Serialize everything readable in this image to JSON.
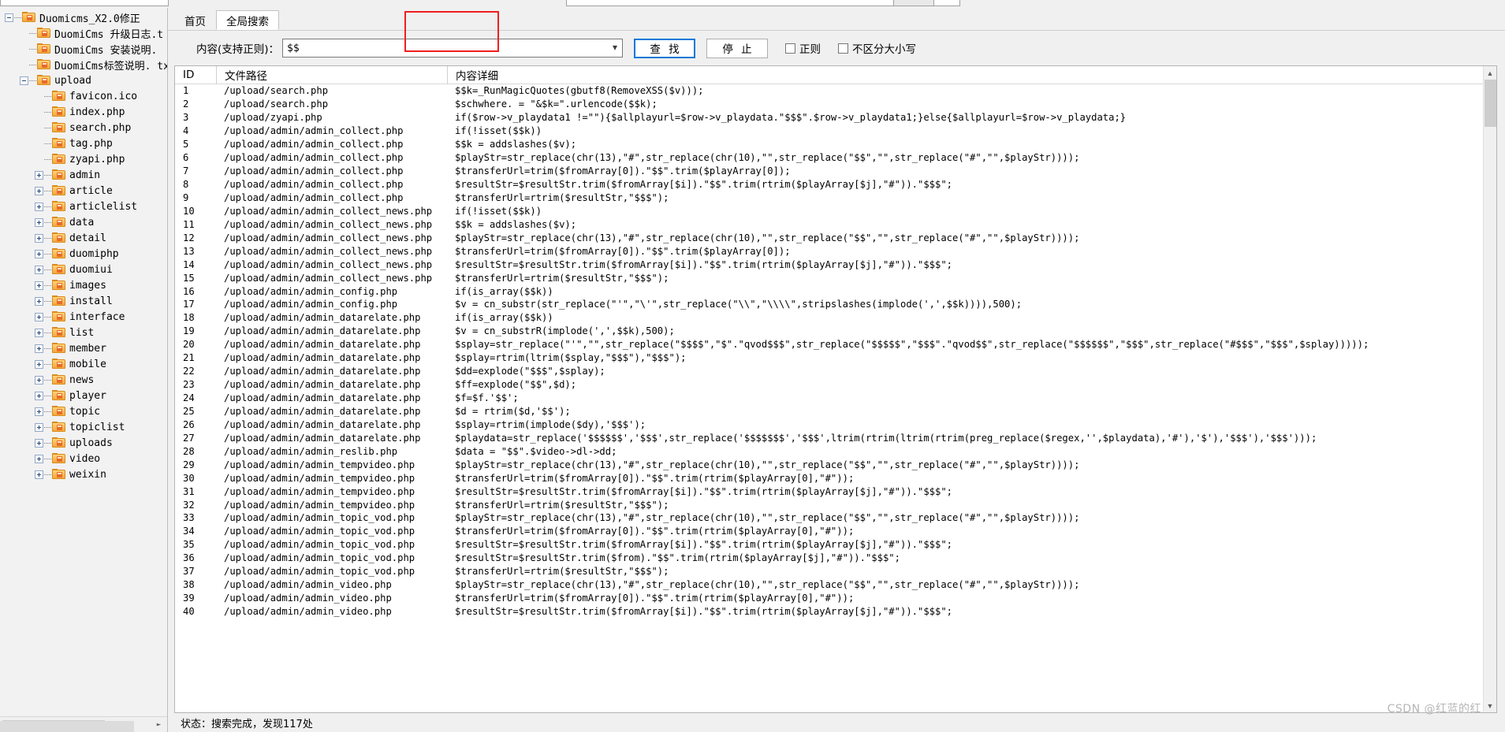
{
  "window": {
    "watermark": "CSDN @红蓝的红"
  },
  "tabs": [
    {
      "label": "首页",
      "active": false
    },
    {
      "label": "全局搜索",
      "active": true
    }
  ],
  "search_form": {
    "content_label": "内容(支持正则)：",
    "content_value": "$$",
    "dropdown_caret": "chevron-down-icon",
    "find_button": "查 找",
    "stop_button": "停 止",
    "regex_checkbox_label": "正则",
    "regex_checked": false,
    "ignorecase_checkbox_label": "不区分大小写",
    "ignorecase_checked": false
  },
  "tree": {
    "nodes": [
      {
        "label": "Duomicms_X2.0修正",
        "depth": 0,
        "toggle": "minus"
      },
      {
        "label": "DuomiCms 升级日志.t",
        "depth": 1,
        "toggle": "none"
      },
      {
        "label": "DuomiCms 安装说明.",
        "depth": 1,
        "toggle": "none"
      },
      {
        "label": "DuomiCms标签说明. tx",
        "depth": 1,
        "toggle": "none"
      },
      {
        "label": "upload",
        "depth": 1,
        "toggle": "minus"
      },
      {
        "label": "favicon.ico",
        "depth": 2,
        "toggle": "none"
      },
      {
        "label": "index.php",
        "depth": 2,
        "toggle": "none"
      },
      {
        "label": "search.php",
        "depth": 2,
        "toggle": "none"
      },
      {
        "label": "tag.php",
        "depth": 2,
        "toggle": "none"
      },
      {
        "label": "zyapi.php",
        "depth": 2,
        "toggle": "none"
      },
      {
        "label": "admin",
        "depth": 2,
        "toggle": "plus"
      },
      {
        "label": "article",
        "depth": 2,
        "toggle": "plus"
      },
      {
        "label": "articlelist",
        "depth": 2,
        "toggle": "plus"
      },
      {
        "label": "data",
        "depth": 2,
        "toggle": "plus"
      },
      {
        "label": "detail",
        "depth": 2,
        "toggle": "plus"
      },
      {
        "label": "duomiphp",
        "depth": 2,
        "toggle": "plus"
      },
      {
        "label": "duomiui",
        "depth": 2,
        "toggle": "plus"
      },
      {
        "label": "images",
        "depth": 2,
        "toggle": "plus"
      },
      {
        "label": "install",
        "depth": 2,
        "toggle": "plus"
      },
      {
        "label": "interface",
        "depth": 2,
        "toggle": "plus"
      },
      {
        "label": "list",
        "depth": 2,
        "toggle": "plus"
      },
      {
        "label": "member",
        "depth": 2,
        "toggle": "plus"
      },
      {
        "label": "mobile",
        "depth": 2,
        "toggle": "plus"
      },
      {
        "label": "news",
        "depth": 2,
        "toggle": "plus"
      },
      {
        "label": "player",
        "depth": 2,
        "toggle": "plus"
      },
      {
        "label": "topic",
        "depth": 2,
        "toggle": "plus"
      },
      {
        "label": "topiclist",
        "depth": 2,
        "toggle": "plus"
      },
      {
        "label": "uploads",
        "depth": 2,
        "toggle": "plus"
      },
      {
        "label": "video",
        "depth": 2,
        "toggle": "plus"
      },
      {
        "label": "weixin",
        "depth": 2,
        "toggle": "plus"
      }
    ]
  },
  "results": {
    "columns": [
      "ID",
      "文件路径",
      "内容详细"
    ],
    "rows": [
      {
        "id": "1",
        "path": "/upload/search.php",
        "detail": "$$k=_RunMagicQuotes(gbutf8(RemoveXSS($v)));"
      },
      {
        "id": "2",
        "path": "/upload/search.php",
        "detail": "$schwhere. = \"&$k=\".urlencode($$k);"
      },
      {
        "id": "3",
        "path": "/upload/zyapi.php",
        "detail": "if($row->v_playdata1 !=\"\"){$allplayurl=$row->v_playdata.\"$$$\".$row->v_playdata1;}else{$allplayurl=$row->v_playdata;}"
      },
      {
        "id": "4",
        "path": "/upload/admin/admin_collect.php",
        "detail": "if(!isset($$k))"
      },
      {
        "id": "5",
        "path": "/upload/admin/admin_collect.php",
        "detail": "$$k = addslashes($v);"
      },
      {
        "id": "6",
        "path": "/upload/admin/admin_collect.php",
        "detail": "$playStr=str_replace(chr(13),\"#\",str_replace(chr(10),\"\",str_replace(\"$$\",\"\",str_replace(\"#\",\"\",$playStr))));"
      },
      {
        "id": "7",
        "path": "/upload/admin/admin_collect.php",
        "detail": "$transferUrl=trim($fromArray[0]).\"$$\".trim($playArray[0]);"
      },
      {
        "id": "8",
        "path": "/upload/admin/admin_collect.php",
        "detail": "$resultStr=$resultStr.trim($fromArray[$i]).\"$$\".trim(rtrim($playArray[$j],\"#\")).\"$$$\";"
      },
      {
        "id": "9",
        "path": "/upload/admin/admin_collect.php",
        "detail": "$transferUrl=rtrim($resultStr,\"$$$\");"
      },
      {
        "id": "10",
        "path": "/upload/admin/admin_collect_news.php",
        "detail": "if(!isset($$k))"
      },
      {
        "id": "11",
        "path": "/upload/admin/admin_collect_news.php",
        "detail": "$$k = addslashes($v);"
      },
      {
        "id": "12",
        "path": "/upload/admin/admin_collect_news.php",
        "detail": "$playStr=str_replace(chr(13),\"#\",str_replace(chr(10),\"\",str_replace(\"$$\",\"\",str_replace(\"#\",\"\",$playStr))));"
      },
      {
        "id": "13",
        "path": "/upload/admin/admin_collect_news.php",
        "detail": "$transferUrl=trim($fromArray[0]).\"$$\".trim($playArray[0]);"
      },
      {
        "id": "14",
        "path": "/upload/admin/admin_collect_news.php",
        "detail": "$resultStr=$resultStr.trim($fromArray[$i]).\"$$\".trim(rtrim($playArray[$j],\"#\")).\"$$$\";"
      },
      {
        "id": "15",
        "path": "/upload/admin/admin_collect_news.php",
        "detail": "$transferUrl=rtrim($resultStr,\"$$$\");"
      },
      {
        "id": "16",
        "path": "/upload/admin/admin_config.php",
        "detail": "if(is_array($$k))"
      },
      {
        "id": "17",
        "path": "/upload/admin/admin_config.php",
        "detail": "$v = cn_substr(str_replace(\"'\",\"\\'\",str_replace(\"\\\\\",\"\\\\\\\\\",stripslashes(implode(',',$$k)))),500);"
      },
      {
        "id": "18",
        "path": "/upload/admin/admin_datarelate.php",
        "detail": "if(is_array($$k))"
      },
      {
        "id": "19",
        "path": "/upload/admin/admin_datarelate.php",
        "detail": "$v = cn_substrR(implode(',',$$k),500);"
      },
      {
        "id": "20",
        "path": "/upload/admin/admin_datarelate.php",
        "detail": "$splay=str_replace(\"'\",\"\",str_replace(\"$$$$\",\"$\".\"qvod$$$\",str_replace(\"$$$$$\",\"$$$\".\"qvod$$\",str_replace(\"$$$$$$\",\"$$$\",str_replace(\"#$$$\",\"$$$\",$splay)))));"
      },
      {
        "id": "21",
        "path": "/upload/admin/admin_datarelate.php",
        "detail": "$splay=rtrim(ltrim($splay,\"$$$\"),\"$$$\");"
      },
      {
        "id": "22",
        "path": "/upload/admin/admin_datarelate.php",
        "detail": "$dd=explode(\"$$$\",$splay);"
      },
      {
        "id": "23",
        "path": "/upload/admin/admin_datarelate.php",
        "detail": "$ff=explode(\"$$\",$d);"
      },
      {
        "id": "24",
        "path": "/upload/admin/admin_datarelate.php",
        "detail": "$f=$f.'$$';"
      },
      {
        "id": "25",
        "path": "/upload/admin/admin_datarelate.php",
        "detail": "$d = rtrim($d,'$$');"
      },
      {
        "id": "26",
        "path": "/upload/admin/admin_datarelate.php",
        "detail": "$splay=rtrim(implode($dy),'$$$');"
      },
      {
        "id": "27",
        "path": "/upload/admin/admin_datarelate.php",
        "detail": "$playdata=str_replace('$$$$$$','$$$',str_replace('$$$$$$$','$$$',ltrim(rtrim(ltrim(rtrim(preg_replace($regex,'',$playdata),'#'),'$'),'$$$'),'$$$')));"
      },
      {
        "id": "28",
        "path": "/upload/admin/admin_reslib.php",
        "detail": "$data = \"$$\".$video->dl->dd;"
      },
      {
        "id": "29",
        "path": "/upload/admin/admin_tempvideo.php",
        "detail": "$playStr=str_replace(chr(13),\"#\",str_replace(chr(10),\"\",str_replace(\"$$\",\"\",str_replace(\"#\",\"\",$playStr))));"
      },
      {
        "id": "30",
        "path": "/upload/admin/admin_tempvideo.php",
        "detail": "$transferUrl=trim($fromArray[0]).\"$$\".trim(rtrim($playArray[0],\"#\"));"
      },
      {
        "id": "31",
        "path": "/upload/admin/admin_tempvideo.php",
        "detail": "$resultStr=$resultStr.trim($fromArray[$i]).\"$$\".trim(rtrim($playArray[$j],\"#\")).\"$$$\";"
      },
      {
        "id": "32",
        "path": "/upload/admin/admin_tempvideo.php",
        "detail": "$transferUrl=rtrim($resultStr,\"$$$\");"
      },
      {
        "id": "33",
        "path": "/upload/admin/admin_topic_vod.php",
        "detail": "$playStr=str_replace(chr(13),\"#\",str_replace(chr(10),\"\",str_replace(\"$$\",\"\",str_replace(\"#\",\"\",$playStr))));"
      },
      {
        "id": "34",
        "path": "/upload/admin/admin_topic_vod.php",
        "detail": "$transferUrl=trim($fromArray[0]).\"$$\".trim(rtrim($playArray[0],\"#\"));"
      },
      {
        "id": "35",
        "path": "/upload/admin/admin_topic_vod.php",
        "detail": "$resultStr=$resultStr.trim($fromArray[$i]).\"$$\".trim(rtrim($playArray[$j],\"#\")).\"$$$\";"
      },
      {
        "id": "36",
        "path": "/upload/admin/admin_topic_vod.php",
        "detail": "$resultStr=$resultStr.trim($from).\"$$\".trim(rtrim($playArray[$j],\"#\")).\"$$$\";"
      },
      {
        "id": "37",
        "path": "/upload/admin/admin_topic_vod.php",
        "detail": "$transferUrl=rtrim($resultStr,\"$$$\");"
      },
      {
        "id": "38",
        "path": "/upload/admin/admin_video.php",
        "detail": "$playStr=str_replace(chr(13),\"#\",str_replace(chr(10),\"\",str_replace(\"$$\",\"\",str_replace(\"#\",\"\",$playStr))));"
      },
      {
        "id": "39",
        "path": "/upload/admin/admin_video.php",
        "detail": "$transferUrl=trim($fromArray[0]).\"$$\".trim(rtrim($playArray[0],\"#\"));"
      },
      {
        "id": "40",
        "path": "/upload/admin/admin_video.php",
        "detail": "$resultStr=$resultStr.trim($fromArray[$i]).\"$$\".trim(rtrim($playArray[$j],\"#\")).\"$$$\";"
      }
    ]
  },
  "statusbar": {
    "text": "状态：搜索完成，发现117处"
  }
}
